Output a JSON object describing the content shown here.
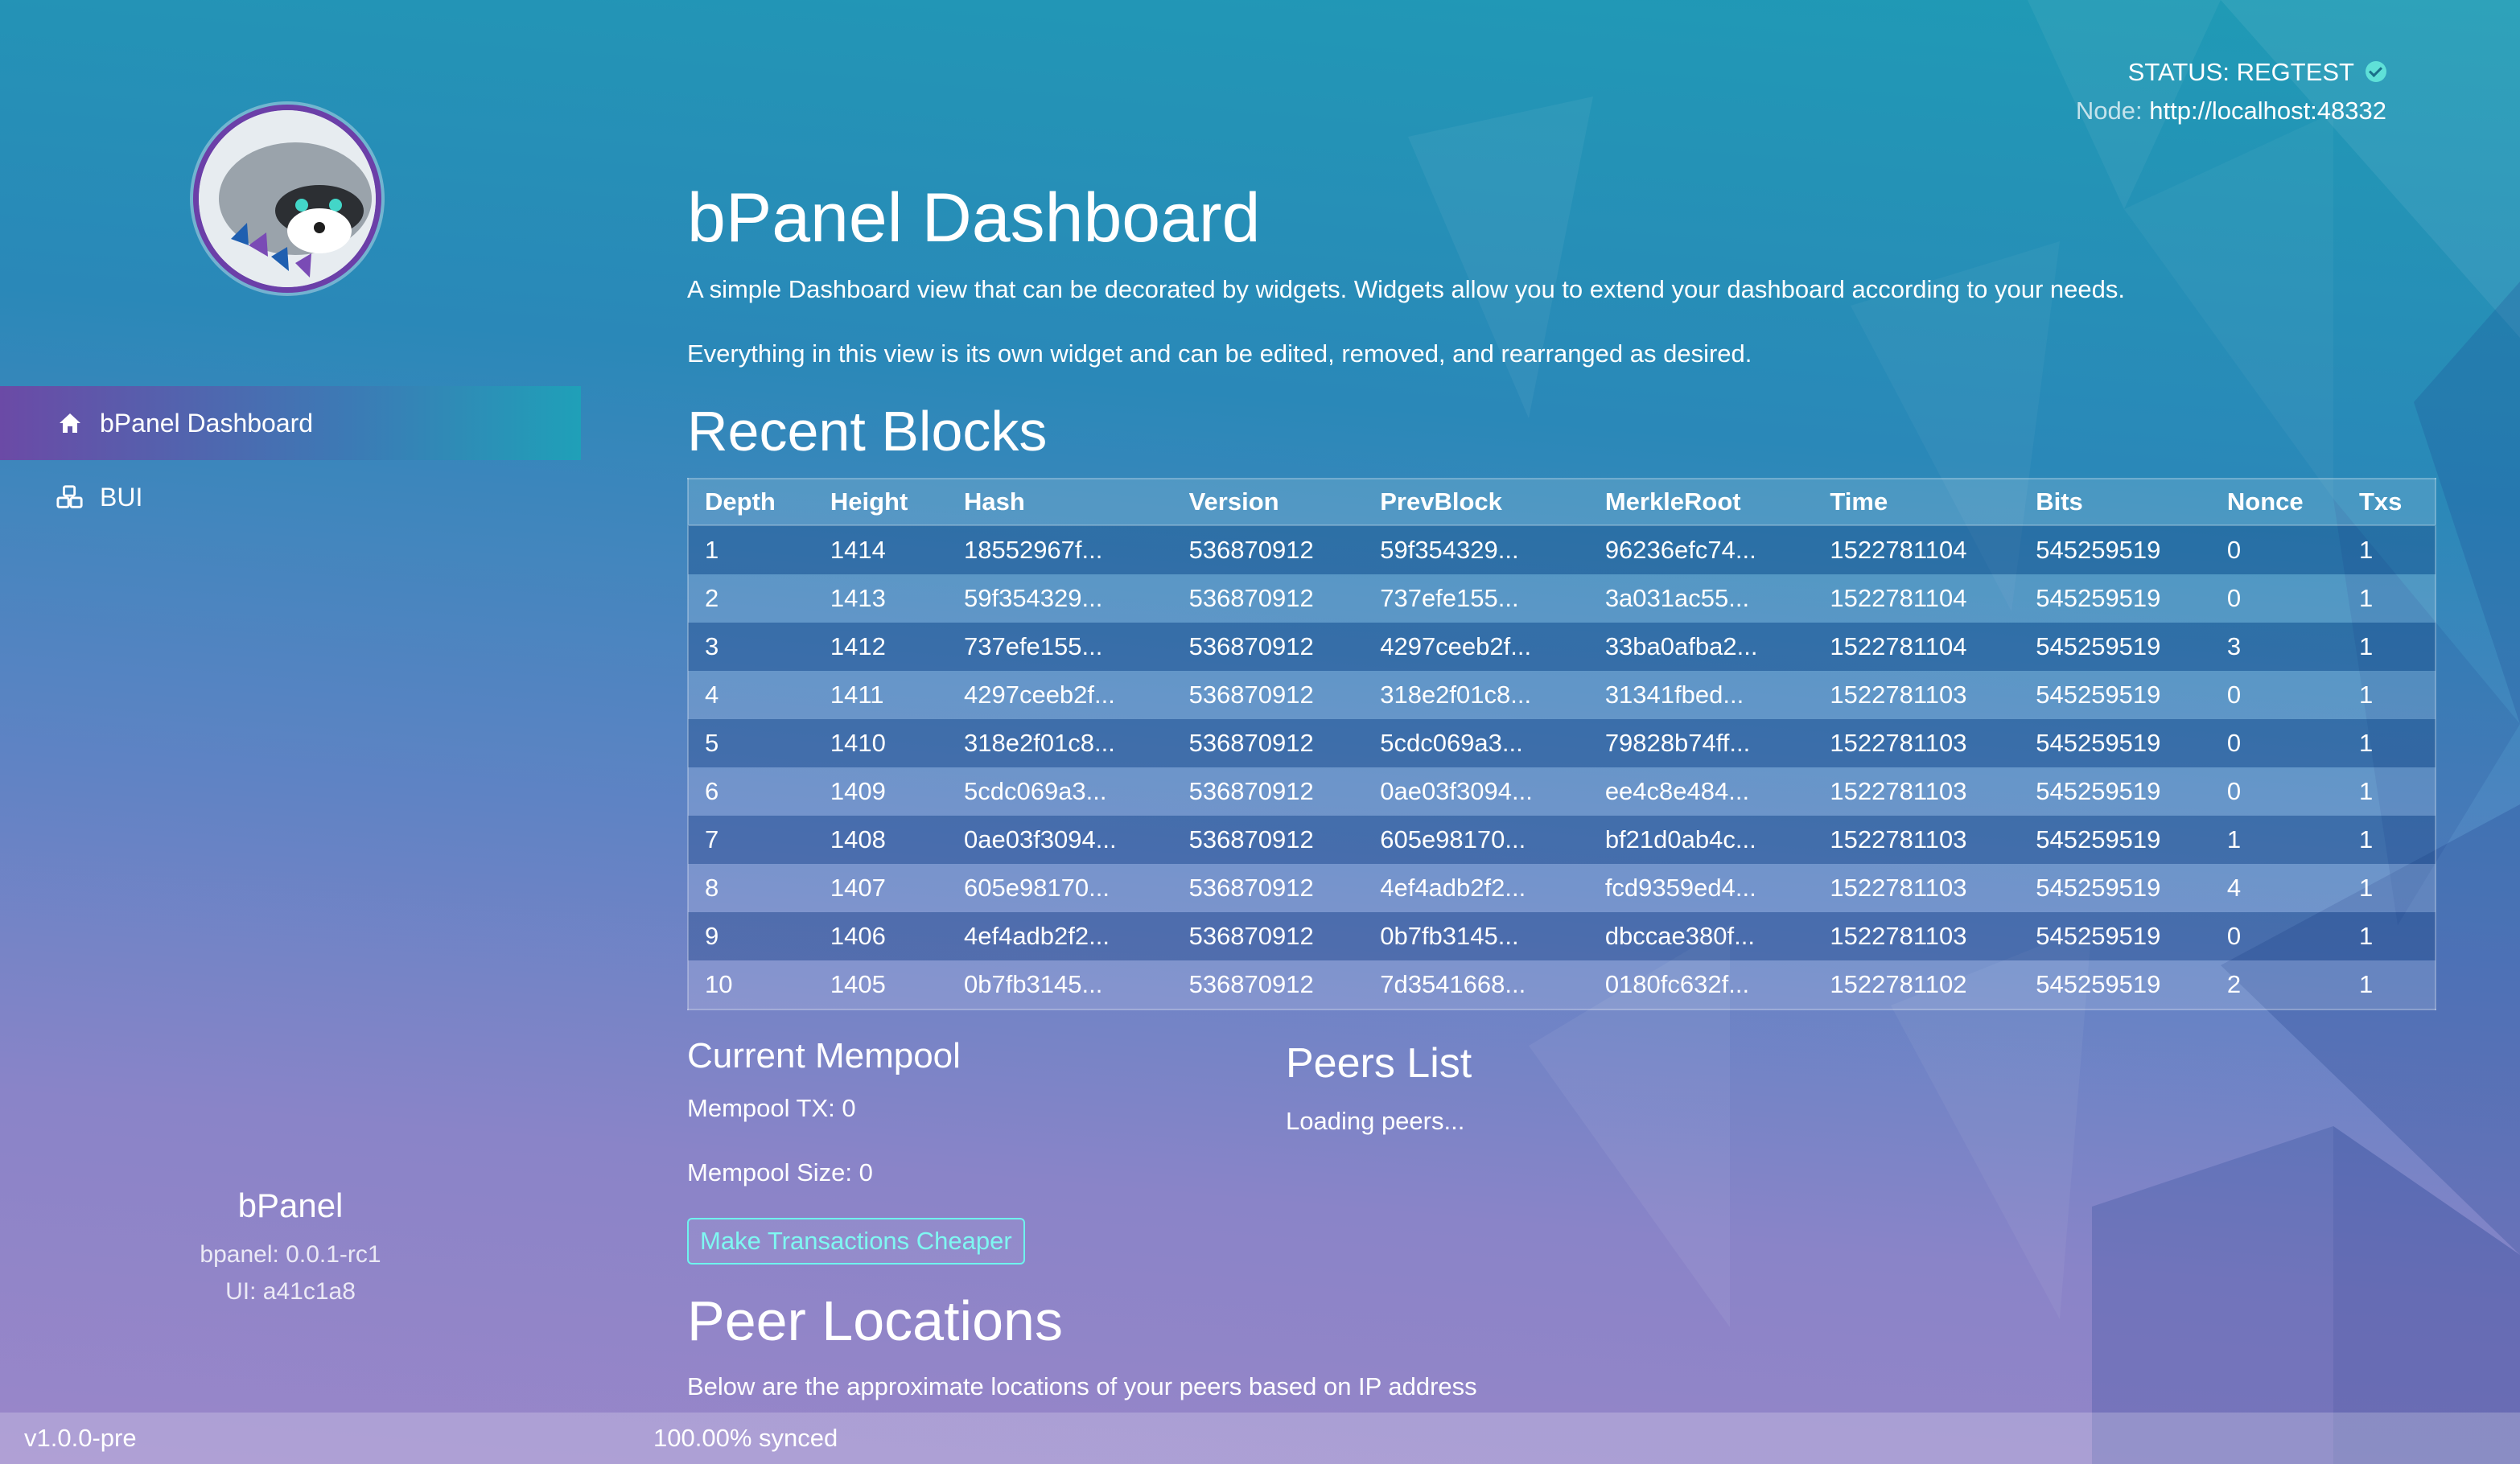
{
  "status": {
    "label": "STATUS: REGTEST",
    "node_label": "Node:",
    "node_url": "http://localhost:48332"
  },
  "sidebar": {
    "items": [
      {
        "label": "bPanel Dashboard",
        "icon": "home-icon",
        "active": true
      },
      {
        "label": "BUI",
        "icon": "cubes-icon",
        "active": false
      }
    ],
    "footer": {
      "app_name": "bPanel",
      "bpanel_version": "bpanel: 0.0.1-rc1",
      "ui_version": "UI: a41c1a8"
    }
  },
  "main": {
    "title": "bPanel Dashboard",
    "description_1": "A simple Dashboard view that can be decorated by widgets. Widgets allow you to extend your dashboard according to your needs.",
    "description_2": "Everything in this view is its own widget and can be edited, removed, and rearranged as desired.",
    "recent_blocks": {
      "heading": "Recent Blocks",
      "columns": [
        "Depth",
        "Height",
        "Hash",
        "Version",
        "PrevBlock",
        "MerkleRoot",
        "Time",
        "Bits",
        "Nonce",
        "Txs"
      ],
      "rows": [
        [
          "1",
          "1414",
          "18552967f...",
          "536870912",
          "59f354329...",
          "96236efc74...",
          "1522781104",
          "545259519",
          "0",
          "1"
        ],
        [
          "2",
          "1413",
          "59f354329...",
          "536870912",
          "737efe155...",
          "3a031ac55...",
          "1522781104",
          "545259519",
          "0",
          "1"
        ],
        [
          "3",
          "1412",
          "737efe155...",
          "536870912",
          "4297ceeb2f...",
          "33ba0afba2...",
          "1522781104",
          "545259519",
          "3",
          "1"
        ],
        [
          "4",
          "1411",
          "4297ceeb2f...",
          "536870912",
          "318e2f01c8...",
          "31341fbed...",
          "1522781103",
          "545259519",
          "0",
          "1"
        ],
        [
          "5",
          "1410",
          "318e2f01c8...",
          "536870912",
          "5cdc069a3...",
          "79828b74ff...",
          "1522781103",
          "545259519",
          "0",
          "1"
        ],
        [
          "6",
          "1409",
          "5cdc069a3...",
          "536870912",
          "0ae03f3094...",
          "ee4c8e484...",
          "1522781103",
          "545259519",
          "0",
          "1"
        ],
        [
          "7",
          "1408",
          "0ae03f3094...",
          "536870912",
          "605e98170...",
          "bf21d0ab4c...",
          "1522781103",
          "545259519",
          "1",
          "1"
        ],
        [
          "8",
          "1407",
          "605e98170...",
          "536870912",
          "4ef4adb2f2...",
          "fcd9359ed4...",
          "1522781103",
          "545259519",
          "4",
          "1"
        ],
        [
          "9",
          "1406",
          "4ef4adb2f2...",
          "536870912",
          "0b7fb3145...",
          "dbccae380f...",
          "1522781103",
          "545259519",
          "0",
          "1"
        ],
        [
          "10",
          "1405",
          "0b7fb3145...",
          "536870912",
          "7d3541668...",
          "0180fc632f...",
          "1522781102",
          "545259519",
          "2",
          "1"
        ]
      ]
    },
    "mempool": {
      "heading": "Current Mempool",
      "tx": "Mempool TX: 0",
      "size": "Mempool Size: 0",
      "button": "Make Transactions Cheaper"
    },
    "peers": {
      "heading": "Peers List",
      "loading": "Loading peers..."
    },
    "peer_locations": {
      "heading": "Peer Locations",
      "description": "Below are the approximate locations of your peers based on IP address"
    }
  },
  "footer": {
    "version": "v1.0.0-pre",
    "sync": "100.00% synced"
  },
  "colors": {
    "accent_button": "#6ef3ee",
    "status_check": "#5fe0d8"
  }
}
